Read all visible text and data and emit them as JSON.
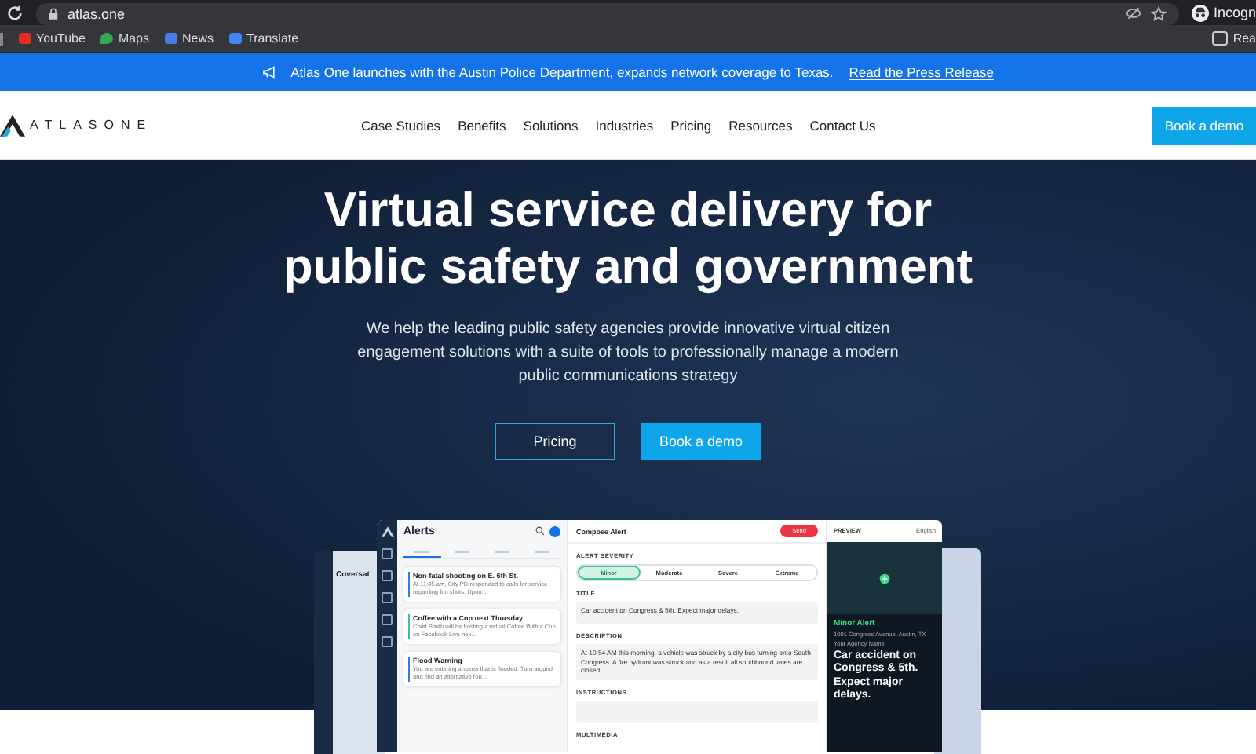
{
  "browser": {
    "url": "atlas.one",
    "profile": "Incogn",
    "bookmarks": [
      {
        "label": "YouTube",
        "kind": "youtube"
      },
      {
        "label": "Maps",
        "kind": "maps"
      },
      {
        "label": "News",
        "kind": "news"
      },
      {
        "label": "Translate",
        "kind": "translate"
      }
    ],
    "reading_list": "Rea"
  },
  "announcement": {
    "text": "Atlas One launches with the Austin Police Department, expands network coverage to Texas.",
    "link": "Read the Press Release"
  },
  "nav": {
    "logo": "ATLASONE",
    "links": [
      "Case Studies",
      "Benefits",
      "Solutions",
      "Industries",
      "Pricing",
      "Resources",
      "Contact Us"
    ],
    "cta": "Book a demo"
  },
  "hero": {
    "title_lines": [
      "Virtual service delivery for",
      "public safety and government"
    ],
    "subtitle": "We help the leading public safety agencies provide innovative virtual citizen engagement solutions with a suite of tools to professionally manage a modern public communications strategy",
    "buttons": [
      {
        "label": "Pricing",
        "kind": "outline"
      },
      {
        "label": "Book a demo",
        "kind": "filled"
      }
    ]
  },
  "mockup": {
    "side_panel_title": "Coversat",
    "alerts": {
      "title": "Alerts",
      "tabs": [
        {
          "selected": true
        },
        {
          "selected": false
        },
        {
          "selected": false
        },
        {
          "selected": false
        }
      ],
      "cards": [
        {
          "title": "Non-fatal shooting on E. 6th St.",
          "body": "At 11:45 am, City PD responded to calls for service regarding fun shots. Upon...",
          "color": "#2e7de0"
        },
        {
          "title": "Coffee with a Cop next Thursday",
          "body": "Chief Smith will be hosting a virtual Coffee With a Cop on Facebook Live nex...",
          "color": "#3cc48a"
        },
        {
          "title": "Flood Warning",
          "body": "You are entering an area that is flooded. Turn around and find an alternative rou...",
          "color": "#2e7de0"
        }
      ]
    },
    "compose": {
      "title": "Compose Alert",
      "send": "Send",
      "severity_label": "ALERT SEVERITY",
      "severities": [
        {
          "label": "Minor",
          "selected": true
        },
        {
          "label": "Moderate",
          "selected": false
        },
        {
          "label": "Severe",
          "selected": false
        },
        {
          "label": "Extreme",
          "selected": false
        }
      ],
      "fields": [
        {
          "label": "TITLE",
          "value": "Car accident on Congress & 5th. Expect major delays."
        },
        {
          "label": "DESCRIPTION",
          "value": "At 10:54 AM this morning, a vehicle was struck by a city bus turning onto South Congress. A fire hydrant was struck and as a result all southbound lanes are closed."
        },
        {
          "label": "INSTRUCTIONS",
          "kind": "empty_input"
        },
        {
          "label": "MULTIMEDIA",
          "kind": "heading"
        }
      ]
    },
    "preview": {
      "label": "PREVIEW",
      "language": "English",
      "alert_type": "Minor Alert",
      "address": "1001 Congress Avenue, Austin, TX",
      "agency": "Your Agency Name",
      "headline": "Car accident on Congress & 5th. Expect major delays."
    }
  }
}
